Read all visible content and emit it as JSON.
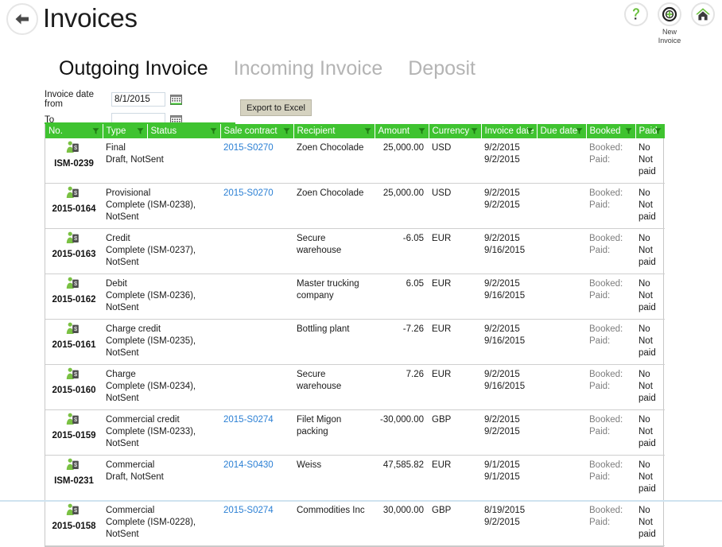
{
  "window": {
    "title": "Invoices"
  },
  "topbar": {
    "back_label": "Back",
    "help_glyph": "?",
    "new_invoice_caption_line1": "New",
    "new_invoice_caption_line2": "Invoice",
    "home_label": "Home",
    "accent_green": "#3fc330",
    "icon_dark": "#3a3a3a"
  },
  "tabs": [
    {
      "label": "Outgoing Invoice",
      "active": true
    },
    {
      "label": "Incoming Invoice",
      "active": false
    },
    {
      "label": "Deposit",
      "active": false
    }
  ],
  "filters": {
    "date_from_label": "Invoice date from",
    "date_from_value": "8/1/2015",
    "date_from_placeholder": "",
    "date_to_label": "To",
    "date_to_value": "",
    "date_to_placeholder": "",
    "calendar_icon": "calendar-icon"
  },
  "toolbar": {
    "export_label": "Export to Excel"
  },
  "table": {
    "columns": [
      {
        "label": "No.",
        "filter_icon": "filter-icon"
      },
      {
        "label": "Type",
        "filter_icon": "filter-icon"
      },
      {
        "label": "Status",
        "filter_icon": "filter-icon"
      },
      {
        "label": "Sale contract",
        "filter_icon": "filter-icon"
      },
      {
        "label": "Recipient",
        "filter_icon": "filter-icon"
      },
      {
        "label": "Amount",
        "filter_icon": "filter-icon"
      },
      {
        "label": "Currency",
        "filter_icon": "filter-icon"
      },
      {
        "label": "Invoice date",
        "filter_icon": "filter-icon"
      },
      {
        "label": "Due date",
        "filter_icon": "filter-icon"
      },
      {
        "label": "Booked",
        "filter_icon": "filter-icon"
      },
      {
        "label": "Paid",
        "filter_icon": "filter-icon"
      }
    ],
    "booked_label": "Booked:",
    "paid_label": "Paid:",
    "rows": [
      {
        "no": "ISM-0239",
        "icon": "invoice-person-dollar-icon",
        "type": "Final",
        "status": "Draft, NotSent",
        "sale_contract": "2015-S0270",
        "recipient": "Zoen Chocolade",
        "amount": "25,000.00",
        "currency": "USD",
        "invoice_date": "9/2/2015",
        "due_date": "9/2/2015",
        "booked": "No",
        "paid": "Not paid"
      },
      {
        "no": "2015-0164",
        "icon": "invoice-person-dollar-icon",
        "type": "Provisional",
        "status": "Complete (ISM-0238), NotSent",
        "sale_contract": "2015-S0270",
        "recipient": "Zoen Chocolade",
        "amount": "25,000.00",
        "currency": "USD",
        "invoice_date": "9/2/2015",
        "due_date": "9/2/2015",
        "booked": "No",
        "paid": "Not paid"
      },
      {
        "no": "2015-0163",
        "icon": "invoice-person-dollar-icon",
        "type": "Credit",
        "status": "Complete (ISM-0237), NotSent",
        "sale_contract": "",
        "recipient": "Secure warehouse",
        "amount": "-6.05",
        "currency": "EUR",
        "invoice_date": "9/2/2015",
        "due_date": "9/16/2015",
        "booked": "No",
        "paid": "Not paid"
      },
      {
        "no": "2015-0162",
        "icon": "invoice-person-dollar-icon",
        "type": "Debit",
        "status": "Complete (ISM-0236), NotSent",
        "sale_contract": "",
        "recipient": "Master trucking company",
        "amount": "6.05",
        "currency": "EUR",
        "invoice_date": "9/2/2015",
        "due_date": "9/16/2015",
        "booked": "No",
        "paid": "Not paid"
      },
      {
        "no": "2015-0161",
        "icon": "invoice-person-dollar-icon",
        "type": "Charge credit",
        "status": "Complete (ISM-0235), NotSent",
        "sale_contract": "",
        "recipient": "Bottling plant",
        "amount": "-7.26",
        "currency": "EUR",
        "invoice_date": "9/2/2015",
        "due_date": "9/16/2015",
        "booked": "No",
        "paid": "Not paid"
      },
      {
        "no": "2015-0160",
        "icon": "invoice-person-dollar-icon",
        "type": "Charge",
        "status": "Complete (ISM-0234), NotSent",
        "sale_contract": "",
        "recipient": "Secure warehouse",
        "amount": "7.26",
        "currency": "EUR",
        "invoice_date": "9/2/2015",
        "due_date": "9/16/2015",
        "booked": "No",
        "paid": "Not paid"
      },
      {
        "no": "2015-0159",
        "icon": "invoice-person-dollar-icon",
        "type": "Commercial credit",
        "status": "Complete (ISM-0233), NotSent",
        "sale_contract": "2015-S0274",
        "recipient": "Filet Migon packing",
        "amount": "-30,000.00",
        "currency": "GBP",
        "invoice_date": "9/2/2015",
        "due_date": "9/2/2015",
        "booked": "No",
        "paid": "Not paid"
      },
      {
        "no": "ISM-0231",
        "icon": "invoice-person-dollar-icon",
        "type": "Commercial",
        "status": "Draft, NotSent",
        "sale_contract": "2014-S0430",
        "recipient": "Weiss",
        "amount": "47,585.82",
        "currency": "EUR",
        "invoice_date": "9/1/2015",
        "due_date": "9/1/2015",
        "booked": "No",
        "paid": "Not paid"
      },
      {
        "no": "2015-0158",
        "icon": "invoice-person-dollar-icon",
        "type": "Commercial",
        "status": "Complete (ISM-0228), NotSent",
        "sale_contract": "2015-S0274",
        "recipient": "Commodities Inc",
        "amount": "30,000.00",
        "currency": "GBP",
        "invoice_date": "8/19/2015",
        "due_date": "9/2/2015",
        "booked": "No",
        "paid": "Not paid"
      }
    ]
  }
}
